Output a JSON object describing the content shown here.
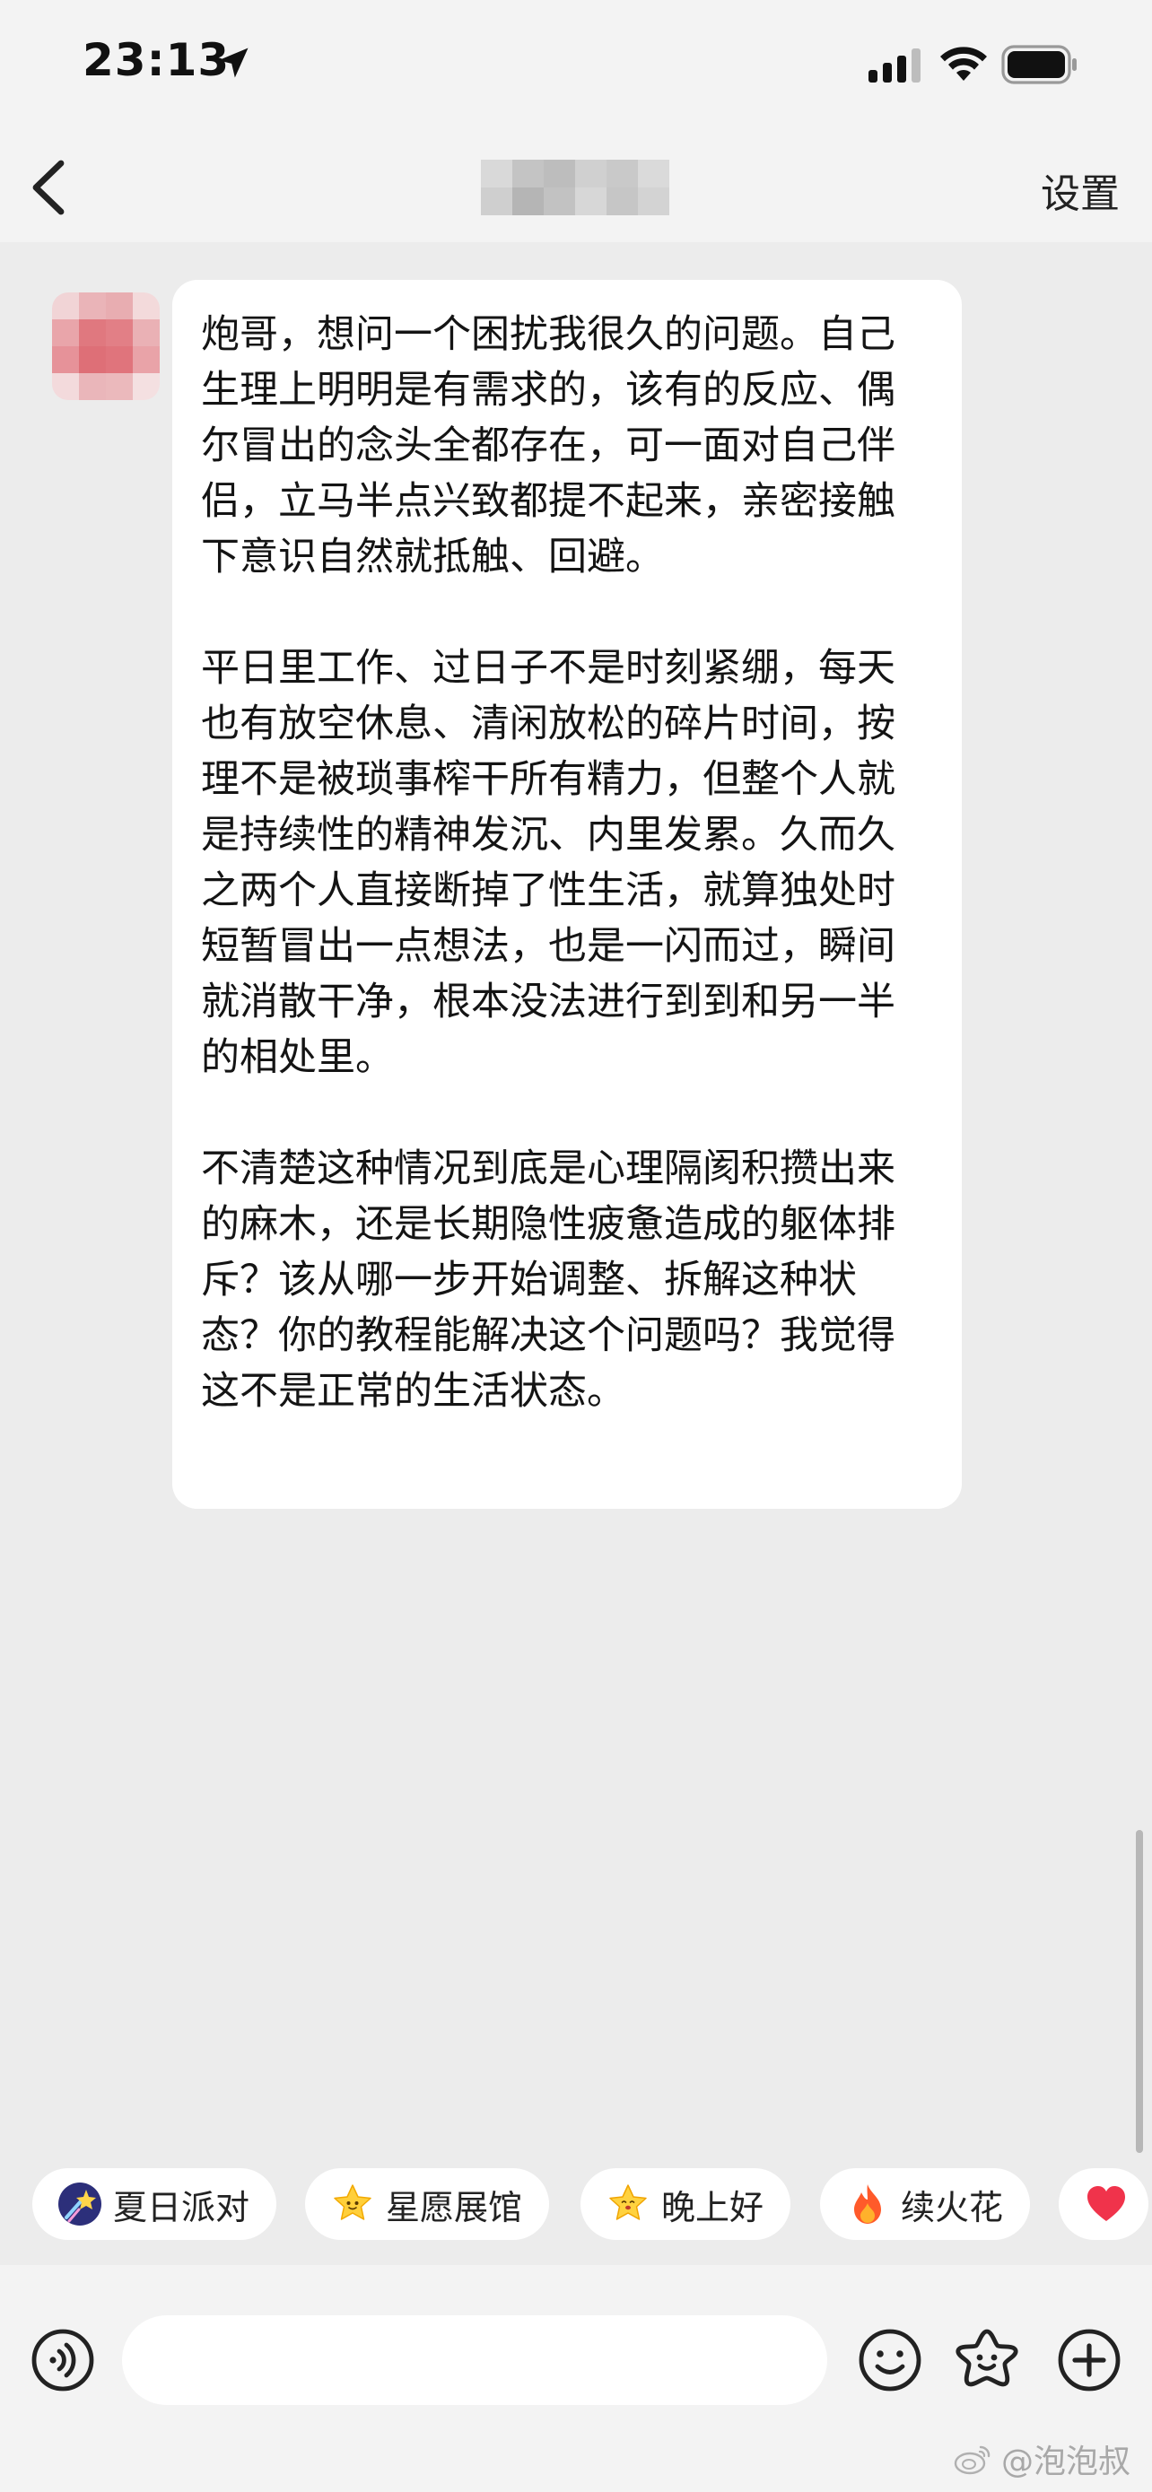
{
  "status_bar": {
    "time": "23:13",
    "icons": [
      "location-arrow-icon",
      "signal-icon",
      "wifi-icon",
      "battery-icon"
    ]
  },
  "nav": {
    "back_icon": "chevron-left-icon",
    "title": "",
    "settings_label": "设置"
  },
  "message": {
    "paragraphs": [
      "炮哥，想问一个困扰我很久的问题。自己生理上明明是有需求的，该有的反应、偶尔冒出的念头全都存在，可一面对自己伴侣，立马半点兴致都提不起来，亲密接触下意识自然就抵触、回避。",
      "平日里工作、过日子不是时刻紧绷，每天也有放空休息、清闲放松的碎片时间，按理不是被琐事榨干所有精力，但整个人就是持续性的精神发沉、内里发累。久而久之两个人直接断掉了性生活，就算独处时短暂冒出一点想法，也是一闪而过，瞬间就消散干净，根本没法进行到到和另一半的相处里。",
      "不清楚这种情况到底是心理隔阂积攒出来的麻木，还是长期隐性疲惫造成的躯体排斥？该从哪一步开始调整、拆解这种状态？你的教程能解决这个问题吗？我觉得这不是正常的生活状态。"
    ]
  },
  "quick_chips": [
    {
      "label": "夏日派对",
      "icon": "shooting-star-icon"
    },
    {
      "label": "星愿展馆",
      "icon": "star-face-icon"
    },
    {
      "label": "晚上好",
      "icon": "star-smile-icon"
    },
    {
      "label": "续火花",
      "icon": "fire-icon"
    },
    {
      "label": "",
      "icon": "heart-icon"
    }
  ],
  "input_bar": {
    "placeholder": "",
    "icons": [
      "voice-icon",
      "emoji-icon",
      "sticker-icon",
      "plus-icon"
    ]
  },
  "watermark": "@泡泡叔",
  "colors": {
    "background": "#ececec",
    "bubble": "#ffffff",
    "bars": "#f3f3f3",
    "text": "#141414"
  }
}
